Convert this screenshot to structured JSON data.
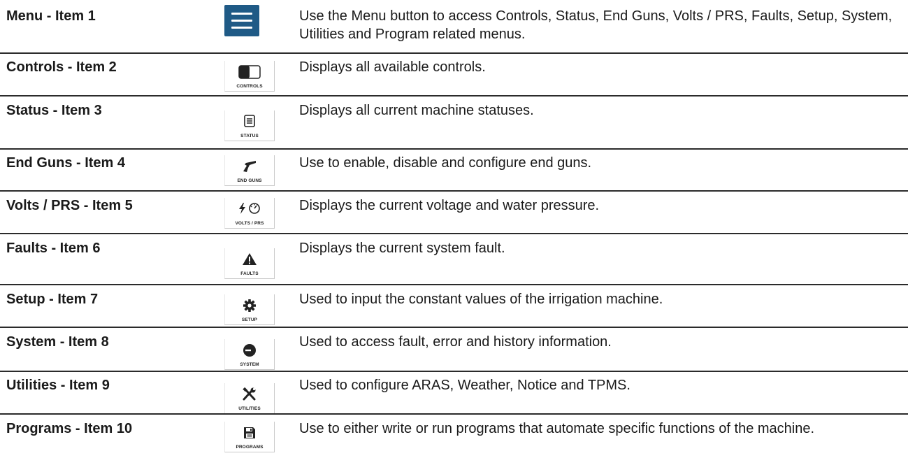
{
  "rows": [
    {
      "label": "Menu - Item 1",
      "icon": "menu-hamburger-icon",
      "icon_label": "",
      "description": "Use the Menu button to access Controls, Status, End Guns, Volts / PRS, Faults, Setup, System, Utilities and Program related menus."
    },
    {
      "label": "Controls - Item 2",
      "icon": "toggle-switch-icon",
      "icon_label": "CONTROLS",
      "description": "Displays all available controls."
    },
    {
      "label": "Status - Item 3",
      "icon": "list-icon",
      "icon_label": "STATUS",
      "description": "Displays all current machine statuses."
    },
    {
      "label": "End Guns - Item 4",
      "icon": "end-gun-icon",
      "icon_label": "END GUNS",
      "description": "Use to enable, disable and configure end guns."
    },
    {
      "label": "Volts / PRS - Item 5",
      "icon": "bolt-gauge-icon",
      "icon_label": "VOLTS / PRS",
      "description": "Displays the current voltage and water pressure."
    },
    {
      "label": "Faults - Item 6",
      "icon": "warning-icon",
      "icon_label": "FAULTS",
      "description": "Displays the current system fault."
    },
    {
      "label": "Setup - Item 7",
      "icon": "gear-icon",
      "icon_label": "SETUP",
      "description": "Used to input the constant values of the irrigation machine."
    },
    {
      "label": "System - Item 8",
      "icon": "system-icon",
      "icon_label": "SYSTEM",
      "description": "Used to access fault, error and history information."
    },
    {
      "label": "Utilities - Item 9",
      "icon": "tools-icon",
      "icon_label": "UTILITIES",
      "description": "Used to configure ARAS, Weather, Notice and TPMS."
    },
    {
      "label": "Programs - Item 10",
      "icon": "save-disk-icon",
      "icon_label": "PROGRAMS",
      "description": "Use to either write or run programs that automate specific functions of the machine."
    }
  ],
  "colors": {
    "menu_button": "#1f5a86",
    "rule": "#2b2b2b"
  }
}
